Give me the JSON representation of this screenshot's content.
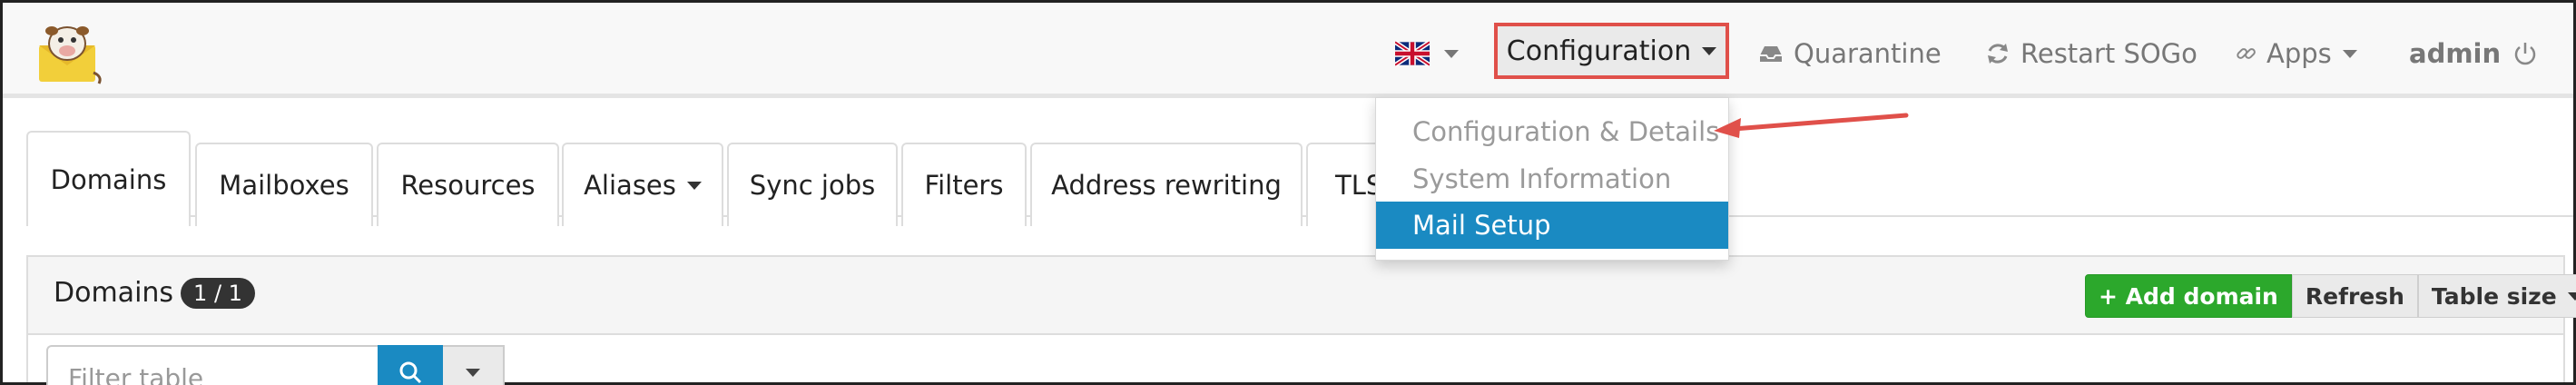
{
  "navbar": {
    "language_flag": "uk-flag-icon",
    "configuration_label": "Configuration",
    "quarantine_label": "Quarantine",
    "restart_label": "Restart SOGo",
    "apps_label": "Apps",
    "user_label": "admin"
  },
  "dropdown": {
    "items": [
      {
        "label": "Configuration & Details"
      },
      {
        "label": "System Information"
      },
      {
        "label": "Mail Setup"
      }
    ]
  },
  "tabs": [
    {
      "label": "Domains"
    },
    {
      "label": "Mailboxes"
    },
    {
      "label": "Resources"
    },
    {
      "label": "Aliases"
    },
    {
      "label": "Sync jobs"
    },
    {
      "label": "Filters"
    },
    {
      "label": "Address rewriting"
    },
    {
      "label": "TLS"
    }
  ],
  "panel": {
    "title": "Domains",
    "count_badge": "1 / 1",
    "add_domain_label": "+ Add domain",
    "refresh_label": "Refresh",
    "table_size_label": "Table size",
    "filter_placeholder": "Filter table"
  },
  "colors": {
    "accent_blue": "#1a8ac2",
    "success_green": "#2ca82c",
    "highlight_red": "#e0504a"
  }
}
